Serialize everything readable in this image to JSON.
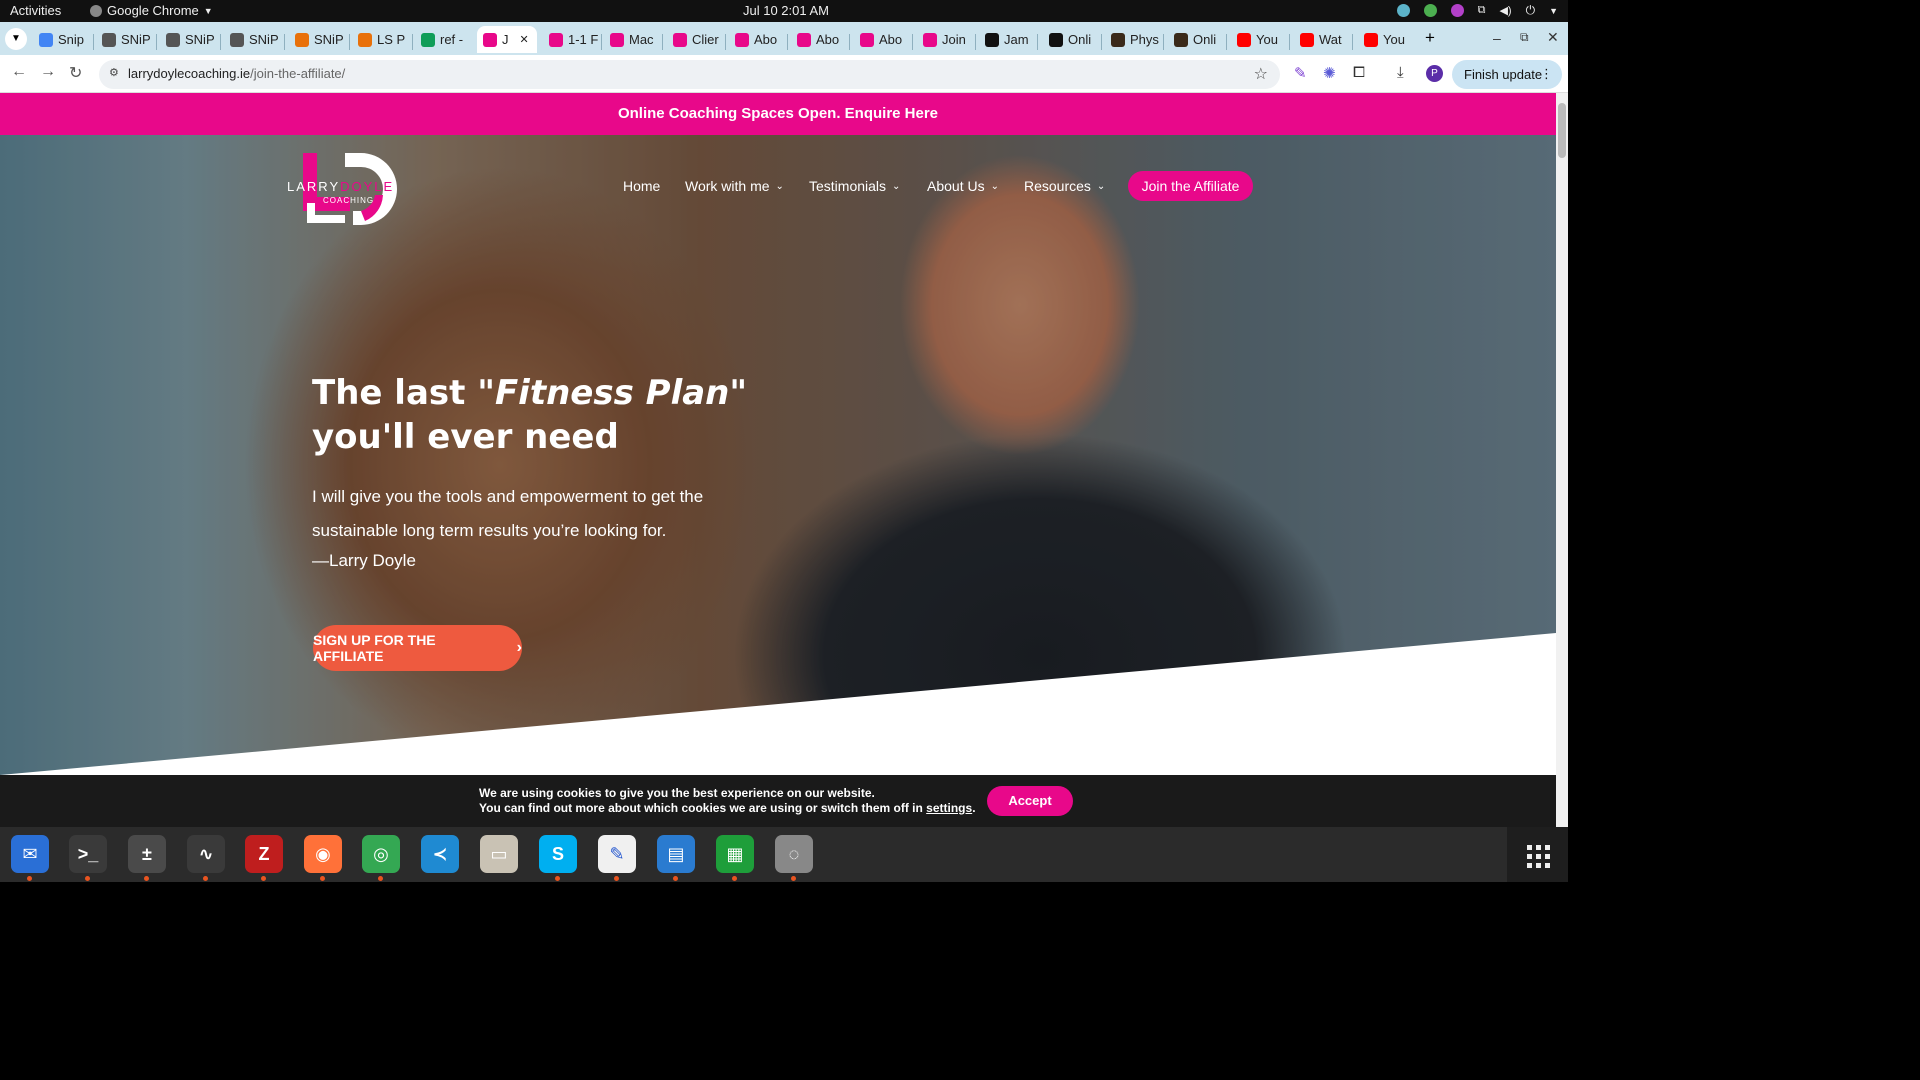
{
  "topbar": {
    "activities": "Activities",
    "app": "Google Chrome",
    "clock": "Jul 10  2:01 AM"
  },
  "tabs": [
    {
      "label": "Snip",
      "color": "#4285f4"
    },
    {
      "label": "SNiP",
      "color": "#555555"
    },
    {
      "label": "SNiP",
      "color": "#555555"
    },
    {
      "label": "SNiP",
      "color": "#555555"
    },
    {
      "label": "SNiP",
      "color": "#e8710a"
    },
    {
      "label": "LS P",
      "color": "#e8710a"
    },
    {
      "label": "ref -",
      "color": "#0f9d58"
    },
    {
      "label": "J",
      "color": "#e8088a"
    },
    {
      "label": "1-1 F",
      "color": "#e8088a"
    },
    {
      "label": "Mac",
      "color": "#e8088a"
    },
    {
      "label": "Clier",
      "color": "#e8088a"
    },
    {
      "label": "Abo",
      "color": "#e8088a"
    },
    {
      "label": "Abo",
      "color": "#e8088a"
    },
    {
      "label": "Abo",
      "color": "#e8088a"
    },
    {
      "label": "Join",
      "color": "#e8088a"
    },
    {
      "label": "Jam",
      "color": "#111111"
    },
    {
      "label": "Onli",
      "color": "#111111"
    },
    {
      "label": "Phys",
      "color": "#3a2a1a"
    },
    {
      "label": "Onli",
      "color": "#3a2a1a"
    },
    {
      "label": "You",
      "color": "#ff0000"
    },
    {
      "label": "Wat",
      "color": "#ff0000"
    },
    {
      "label": "You",
      "color": "#ff0000"
    }
  ],
  "toolbar": {
    "url_domain": "larrydoylecoaching.ie",
    "url_path": "/join-the-affiliate/",
    "finish_update": "Finish update",
    "profile_initial": "P"
  },
  "site": {
    "banner": "Online Coaching Spaces Open. Enquire Here",
    "logo": {
      "left": "LARRY",
      "right": "DOYLE",
      "sub": "COACHING"
    },
    "nav": [
      "Home",
      "Work with me",
      "Testimonials",
      "About Us",
      "Resources"
    ],
    "join_button": "Join the Affiliate",
    "headline_pre": "The last \"",
    "headline_em": "Fitness Plan",
    "headline_post": "\"",
    "headline_line2": "you'll ever need",
    "subtext": "I will give you the tools and empowerment to get the sustainable long term results you’re looking for.",
    "signature": "—Larry Doyle",
    "cta": "SIGN UP FOR THE AFFILIATE",
    "brand_pink": "#e8088a",
    "cta_orange": "#ee5a3f"
  },
  "cookie": {
    "line1": "We are using cookies to give you the best experience on our website.",
    "line2_pre": "You can find out more about which cookies we are using or switch them off in ",
    "settings_link": "settings",
    "line2_post": ".",
    "accept": "Accept"
  },
  "dock": [
    {
      "name": "thunderbird-icon",
      "color": "#2a6fd6"
    },
    {
      "name": "terminal-icon",
      "color": "#3a3a3a"
    },
    {
      "name": "calculator-icon",
      "color": "#4a4a4a"
    },
    {
      "name": "system-monitor-icon",
      "color": "#3a3a3a"
    },
    {
      "name": "filezilla-icon",
      "color": "#bf1e1e"
    },
    {
      "name": "firefox-icon",
      "color": "#ff7139"
    },
    {
      "name": "chrome-icon",
      "color": "#34a853"
    },
    {
      "name": "vscode-icon",
      "color": "#1f8ad2"
    },
    {
      "name": "files-icon",
      "color": "#c9c2b4"
    },
    {
      "name": "skype-icon",
      "color": "#00aff0"
    },
    {
      "name": "text-editor-icon",
      "color": "#f0f0f0"
    },
    {
      "name": "writer-icon",
      "color": "#2a7bd0"
    },
    {
      "name": "calc-sheet-icon",
      "color": "#1e9e3a"
    },
    {
      "name": "disk-icon",
      "color": "#888888"
    }
  ]
}
